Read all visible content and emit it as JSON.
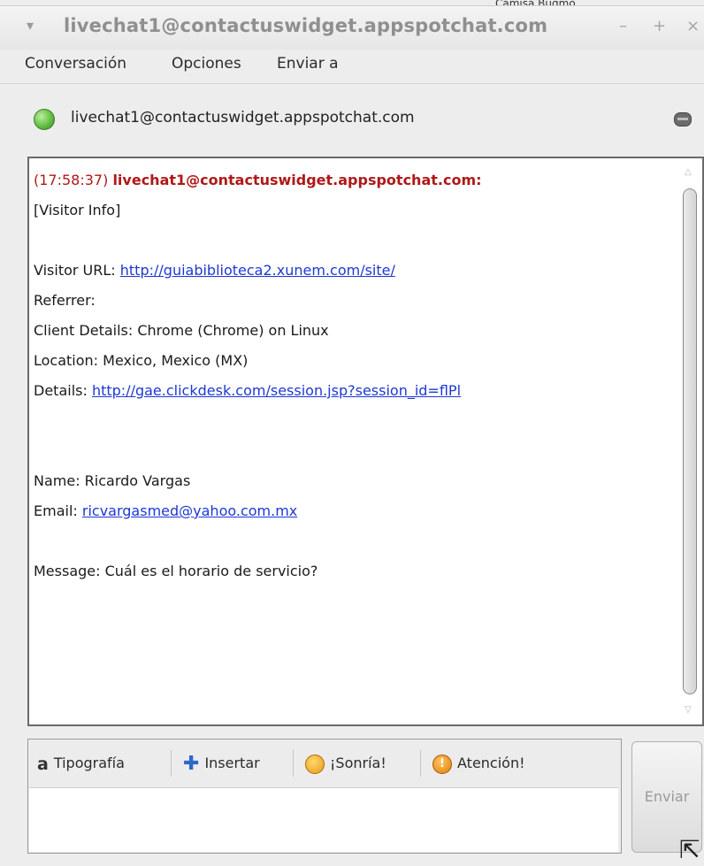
{
  "background_peek": "Camisa Bugmo",
  "window": {
    "title": "livechat1@contactuswidget.appspotchat.com",
    "menu_glyph": "▾",
    "min_glyph": "–",
    "max_glyph": "+",
    "close_glyph": "×"
  },
  "menubar": {
    "items": [
      "Conversación",
      "Opciones",
      "Enviar a"
    ]
  },
  "contact": {
    "name": "livechat1@contactuswidget.appspotchat.com",
    "status_color": "#5dba3e"
  },
  "conversation": {
    "timestamp": "(17:58:37)",
    "sender": "livechat1@contactuswidget.appspotchat.com:",
    "lines": {
      "visitor_info": "[Visitor Info]",
      "visitor_url_label": "Visitor URL: ",
      "visitor_url": "http://guiabiblioteca2.xunem.com/site/",
      "referrer": "Referrer:",
      "client_details": "Client Details: Chrome (Chrome) on Linux",
      "location": "Location: Mexico, Mexico (MX)",
      "details_label": "Details: ",
      "details_url": "http://gae.clickdesk.com/session.jsp?session_id=flPl",
      "name": "Name: Ricardo Vargas",
      "email_label": "Email: ",
      "email": "ricvargasmed@yahoo.com.mx",
      "message": "Message: Cuál es el horario de servicio?"
    }
  },
  "toolbar": {
    "font": "Tipografía",
    "insert": "Insertar",
    "smile": "¡Sonría!",
    "attention": "Atención!"
  },
  "input": {
    "value": ""
  },
  "send_button": {
    "label": "Enviar"
  },
  "colors": {
    "sender": "#b01818",
    "link": "#1c38d6"
  }
}
